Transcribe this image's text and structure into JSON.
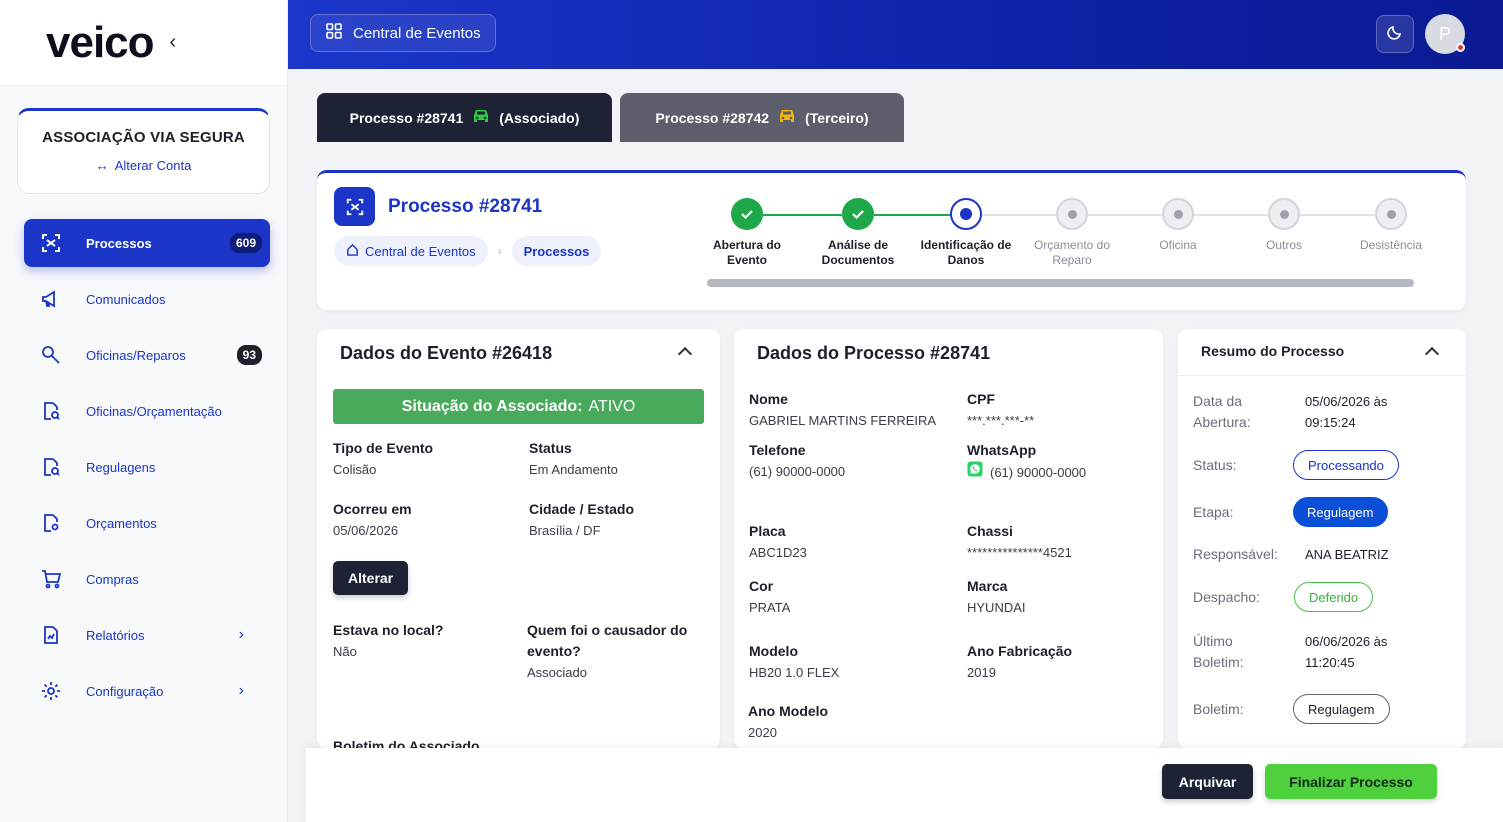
{
  "app": {
    "logo": "veico"
  },
  "account": {
    "name": "ASSOCIAÇÃO VIA SEGURA",
    "switch_label": "Alterar Conta",
    "switch_icon": "swap-arrows-icon"
  },
  "sidebar": {
    "items": [
      {
        "label": "Processos",
        "icon": "processes-icon",
        "badge": "609",
        "active": true
      },
      {
        "label": "Comunicados",
        "icon": "megaphone-icon"
      },
      {
        "label": "Oficinas/Reparos",
        "icon": "wrench-icon",
        "badge": "93"
      },
      {
        "label": "Oficinas/Orçamentação",
        "icon": "document-search-icon"
      },
      {
        "label": "Regulagens",
        "icon": "document-search-icon"
      },
      {
        "label": "Orçamentos",
        "icon": "document-gear-icon"
      },
      {
        "label": "Compras",
        "icon": "cart-icon"
      },
      {
        "label": "Relatórios",
        "icon": "report-icon",
        "chevron": true
      },
      {
        "label": "Configuração",
        "icon": "gear-icon",
        "chevron": true
      }
    ]
  },
  "header": {
    "button_label": "Central de Eventos",
    "button_icon": "grid-icon",
    "avatar_initial": "P",
    "theme_icon": "moon-icon"
  },
  "tabs": [
    {
      "label_process": "Processo #28741",
      "label_role": "(Associado)",
      "car_color": "#2ecc40"
    },
    {
      "label_process": "Processo #28742",
      "label_role": "(Terceiro)",
      "car_color": "#f4b400"
    }
  ],
  "process": {
    "title": "Processo #28741",
    "breadcrumb": {
      "home": "Central de Eventos",
      "current": "Processos"
    },
    "steps": [
      {
        "label": "Abertura do Evento",
        "state": "done"
      },
      {
        "label": "Análise de Documentos",
        "state": "done"
      },
      {
        "label": "Identificação de Danos",
        "state": "current"
      },
      {
        "label": "Orçamento do Reparo",
        "state": "todo"
      },
      {
        "label": "Oficina",
        "state": "todo"
      },
      {
        "label": "Outros",
        "state": "todo"
      },
      {
        "label": "Desistência",
        "state": "todo"
      }
    ]
  },
  "event": {
    "title": "Dados do Evento #26418",
    "status_banner_label": "Situação do Associado:",
    "status_banner_value": "ATIVO",
    "type_label": "Tipo de Evento",
    "type_value": "Colisão",
    "status_label": "Status",
    "status_value": "Em Andamento",
    "occurred_label": "Ocorreu em",
    "occurred_value": "05/06/2026",
    "city_label": "Cidade / Estado",
    "city_value": "Brasília / DF",
    "alter_label": "Alterar",
    "present_label": "Estava no local?",
    "present_value": "Não",
    "cause_label": "Quem foi o causador do evento?",
    "cause_value": "Associado",
    "bulletin_label": "Boletim do Associado"
  },
  "proc_data": {
    "title": "Dados do Processo #28741",
    "name_label": "Nome",
    "name_value": "GABRIEL MARTINS FERREIRA",
    "cpf_label": "CPF",
    "cpf_value": "***.***.***-**",
    "phone_label": "Telefone",
    "phone_value": "(61) 90000-0000",
    "whatsapp_label": "WhatsApp",
    "whatsapp_value": "(61) 90000-0000",
    "plate_label": "Placa",
    "plate_value": "ABC1D23",
    "chassis_label": "Chassi",
    "chassis_value": "***************4521",
    "color_label": "Cor",
    "color_value": "PRATA",
    "brand_label": "Marca",
    "brand_value": "HYUNDAI",
    "model_label": "Modelo",
    "model_value": "HB20 1.0 FLEX",
    "year_fab_label": "Ano Fabricação",
    "year_fab_value": "2019",
    "year_model_label": "Ano Modelo",
    "year_model_value": "2020"
  },
  "summary": {
    "title": "Resumo do Processo",
    "opening_label": "Data da Abertura:",
    "opening_value": "05/06/2026 às 09:15:24",
    "status_label": "Status:",
    "status_value": "Processando",
    "stage_label": "Etapa:",
    "stage_value": "Regulagem",
    "resp_label": "Responsável:",
    "resp_value": "ANA BEATRIZ",
    "dispatch_label": "Despacho:",
    "dispatch_value": "Deferido",
    "last_label": "Último Boletim:",
    "last_value": "06/06/2026 às 11:20:45",
    "bulletin_label": "Boletim:",
    "bulletin_value": "Regulagem"
  },
  "footer": {
    "archive_label": "Arquivar",
    "finish_label": "Finalizar Processo"
  },
  "colors": {
    "primary": "#1a35c7",
    "success": "#1ea84a",
    "dark": "#1d2235",
    "finish": "#4fd13d"
  }
}
